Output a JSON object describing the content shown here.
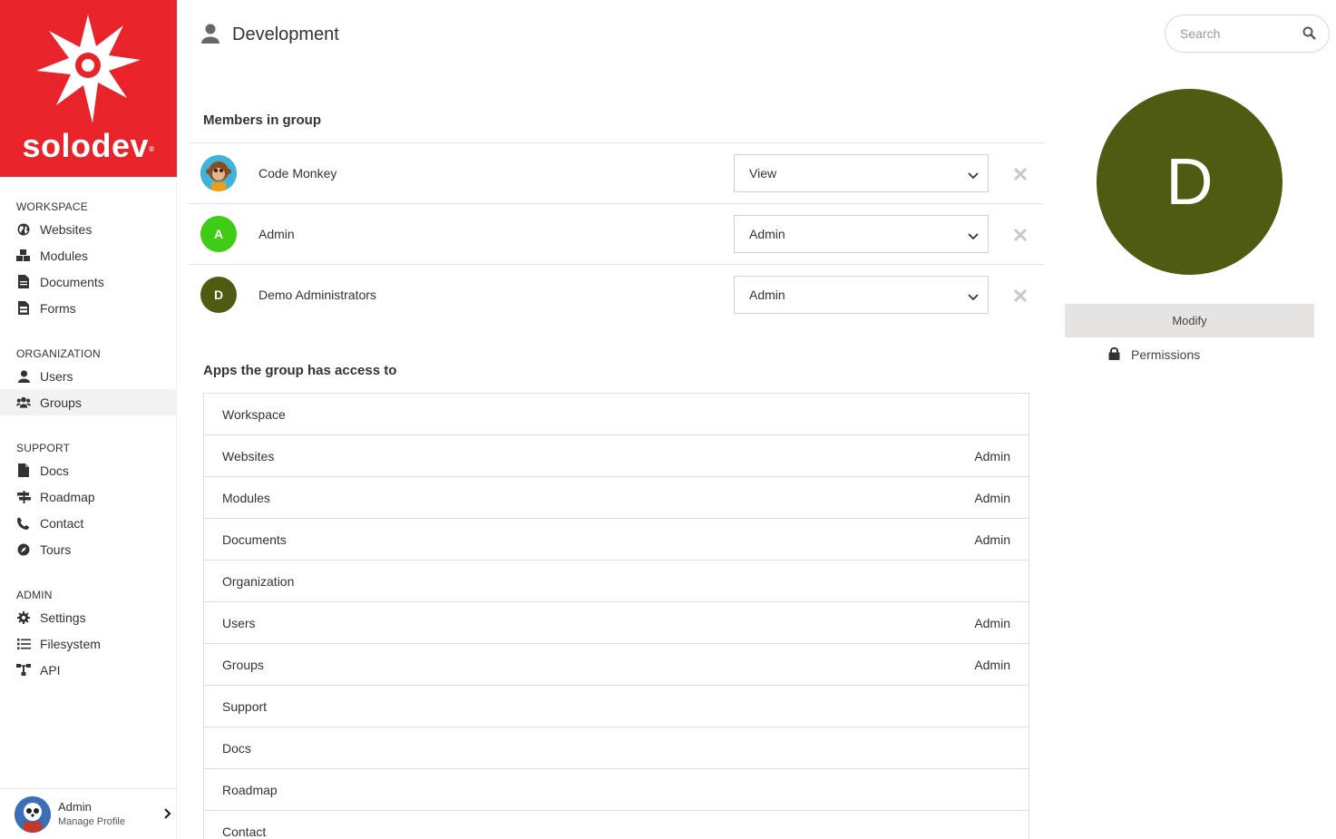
{
  "brand": {
    "name": "solodev",
    "mark": "®",
    "color": "#e8232a"
  },
  "sidebar": {
    "sections": [
      {
        "title": "WORKSPACE",
        "items": [
          {
            "label": "Websites",
            "icon": "globe-icon"
          },
          {
            "label": "Modules",
            "icon": "cubes-icon"
          },
          {
            "label": "Documents",
            "icon": "document-icon"
          },
          {
            "label": "Forms",
            "icon": "form-icon"
          }
        ]
      },
      {
        "title": "ORGANIZATION",
        "items": [
          {
            "label": "Users",
            "icon": "user-icon"
          },
          {
            "label": "Groups",
            "icon": "users-icon",
            "active": true
          }
        ]
      },
      {
        "title": "SUPPORT",
        "items": [
          {
            "label": "Docs",
            "icon": "file-icon"
          },
          {
            "label": "Roadmap",
            "icon": "signpost-icon"
          },
          {
            "label": "Contact",
            "icon": "phone-icon"
          },
          {
            "label": "Tours",
            "icon": "compass-icon"
          }
        ]
      },
      {
        "title": "ADMIN",
        "items": [
          {
            "label": "Settings",
            "icon": "gear-icon"
          },
          {
            "label": "Filesystem",
            "icon": "list-icon"
          },
          {
            "label": "API",
            "icon": "sitemap-icon"
          }
        ]
      }
    ],
    "profile": {
      "name": "Admin",
      "sub": "Manage Profile"
    }
  },
  "header": {
    "title": "Development",
    "search_placeholder": "Search"
  },
  "members": {
    "title": "Members in group",
    "rows": [
      {
        "name": "Code Monkey",
        "initial": "",
        "color": "#3fb3d9",
        "role": "View"
      },
      {
        "name": "Admin",
        "initial": "A",
        "color": "#3ecc14",
        "role": "Admin"
      },
      {
        "name": "Demo Administrators",
        "initial": "D",
        "color": "#4e5b10",
        "role": "Admin"
      }
    ]
  },
  "apps": {
    "title": "Apps the group has access to",
    "rows": [
      {
        "name": "Workspace",
        "role": ""
      },
      {
        "name": "Websites",
        "role": "Admin"
      },
      {
        "name": "Modules",
        "role": "Admin"
      },
      {
        "name": "Documents",
        "role": "Admin"
      },
      {
        "name": "Organization",
        "role": ""
      },
      {
        "name": "Users",
        "role": "Admin"
      },
      {
        "name": "Groups",
        "role": "Admin"
      },
      {
        "name": "Support",
        "role": ""
      },
      {
        "name": "Docs",
        "role": ""
      },
      {
        "name": "Roadmap",
        "role": ""
      },
      {
        "name": "Contact",
        "role": ""
      }
    ]
  },
  "panel": {
    "initial": "D",
    "avatar_color": "#4e5b10",
    "modify_label": "Modify",
    "permissions_label": "Permissions"
  }
}
